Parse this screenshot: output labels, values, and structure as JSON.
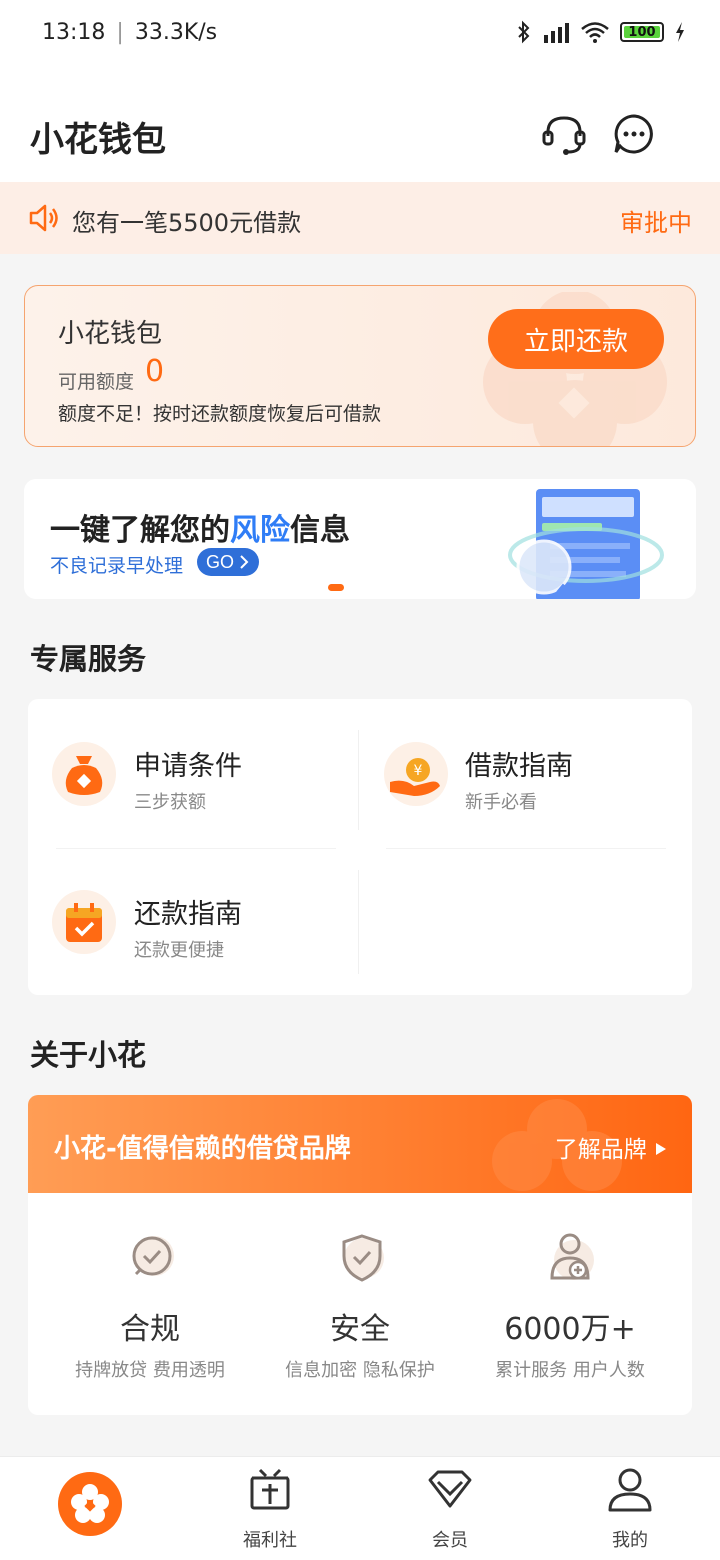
{
  "status_bar": {
    "time": "13:18",
    "speed": "33.3K/s",
    "battery": "100"
  },
  "header": {
    "title": "小花钱包",
    "icons": [
      "headset-icon",
      "chat-bubble-icon"
    ]
  },
  "notice": {
    "text": "您有一笔5500元借款",
    "status": "审批中"
  },
  "wallet": {
    "title": "小花钱包",
    "quota_label": "可用额度",
    "quota_value": "0",
    "hint": "额度不足！按时还款额度恢复后可借款",
    "button": "立即还款"
  },
  "risk_banner": {
    "title_pre": "一键了解您的",
    "title_highlight": "风险",
    "title_post": "信息",
    "subtitle": "不良记录早处理",
    "go_label": "GO"
  },
  "services": {
    "title": "专属服务",
    "items": [
      {
        "name": "申请条件",
        "sub": "三步获额",
        "icon": "money-bag-icon"
      },
      {
        "name": "借款指南",
        "sub": "新手必看",
        "icon": "coin-hand-icon"
      },
      {
        "name": "还款指南",
        "sub": "还款更便捷",
        "icon": "calendar-check-icon"
      }
    ]
  },
  "about": {
    "title": "关于小花",
    "banner_text": "小花-值得信赖的借贷品牌",
    "banner_link": "了解品牌",
    "features": [
      {
        "name": "合规",
        "sub": "持牌放贷  费用透明",
        "icon": "compliance-check-icon"
      },
      {
        "name": "安全",
        "sub": "信息加密  隐私保护",
        "icon": "shield-check-icon"
      },
      {
        "name": "6000万+",
        "sub": "累计服务  用户人数",
        "icon": "user-add-icon"
      }
    ]
  },
  "bottom_nav": {
    "items": [
      {
        "label": "",
        "icon": "flower-logo-icon"
      },
      {
        "label": "福利社",
        "icon": "gift-icon"
      },
      {
        "label": "会员",
        "icon": "diamond-icon"
      },
      {
        "label": "我的",
        "icon": "person-icon"
      }
    ]
  },
  "colors": {
    "accent": "#ff6a13",
    "blue": "#2f6fd8",
    "notice_bg": "#fdeee6"
  }
}
